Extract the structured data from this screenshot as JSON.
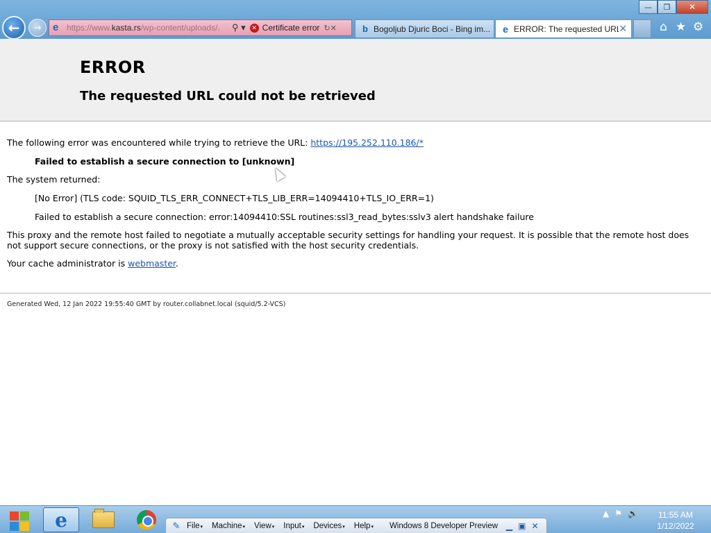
{
  "window": {
    "minimize_glyph": "—",
    "restore_glyph": "❐",
    "close_glyph": "✕"
  },
  "address_bar": {
    "url_prefix": "https://www.",
    "url_host": "kasta.rs",
    "url_rest": "/wp-content/uploads/.",
    "tools_glyph": "⚲ ▾",
    "cert_label": "Certificate error",
    "cert_glyph": "✕",
    "refresh_glyph": "↻✕"
  },
  "tabs": [
    {
      "label": "Bogoljub Djuric Boci - Bing im...",
      "icon": "bing-icon",
      "glyph": "b"
    },
    {
      "label": "ERROR: The requested URL ...",
      "icon": "ie-icon",
      "glyph": "e",
      "close": "✕"
    }
  ],
  "toolbar_icons": [
    "⌂",
    "★",
    "⚙"
  ],
  "page": {
    "title": "ERROR",
    "subtitle": "The requested URL could not be retrieved",
    "intro_text": "The following error was encountered while trying to retrieve the URL: ",
    "intro_link": "https://195.252.110.186/*",
    "failed_bold": "Failed to establish a secure connection to [unknown]",
    "system_returned": "The system returned:",
    "no_error": "[No Error] (TLS code: SQUID_TLS_ERR_CONNECT+TLS_LIB_ERR=14094410+TLS_IO_ERR=1)",
    "failed_detail": "Failed to establish a secure connection: error:14094410:SSL routines:ssl3_read_bytes:sslv3 alert handshake failure",
    "proxy_text": "This proxy and the remote host failed to negotiate a mutually acceptable security settings for handling your request. It is possible that the remote host does not support secure connections, or the proxy is not satisfied with the host security credentials.",
    "admin_prefix": "Your cache administrator is ",
    "admin_link": "webmaster",
    "admin_suffix": ".",
    "footer": "Generated Wed, 12 Jan 2022 19:55:40 GMT by router.collabnet.local (squid/5.2-VCS)"
  },
  "taskbar": {
    "ie_glyph": "e",
    "vbox_menus": [
      "File",
      "Machine",
      "View",
      "Input",
      "Devices",
      "Help"
    ],
    "vbox_title": "Windows 8 Developer Preview",
    "vbox_controls": [
      "▁",
      "▣",
      "✕"
    ],
    "tray_glyphs": [
      "▲",
      "⚑",
      "🔊"
    ],
    "time": "11:55 AM",
    "date": "1/12/2022"
  },
  "colors": {
    "titlebar": "#6aa6d6",
    "cert_error_bar": "#e79fb3",
    "link": "#1a55b4",
    "header_band": "#efefef"
  }
}
